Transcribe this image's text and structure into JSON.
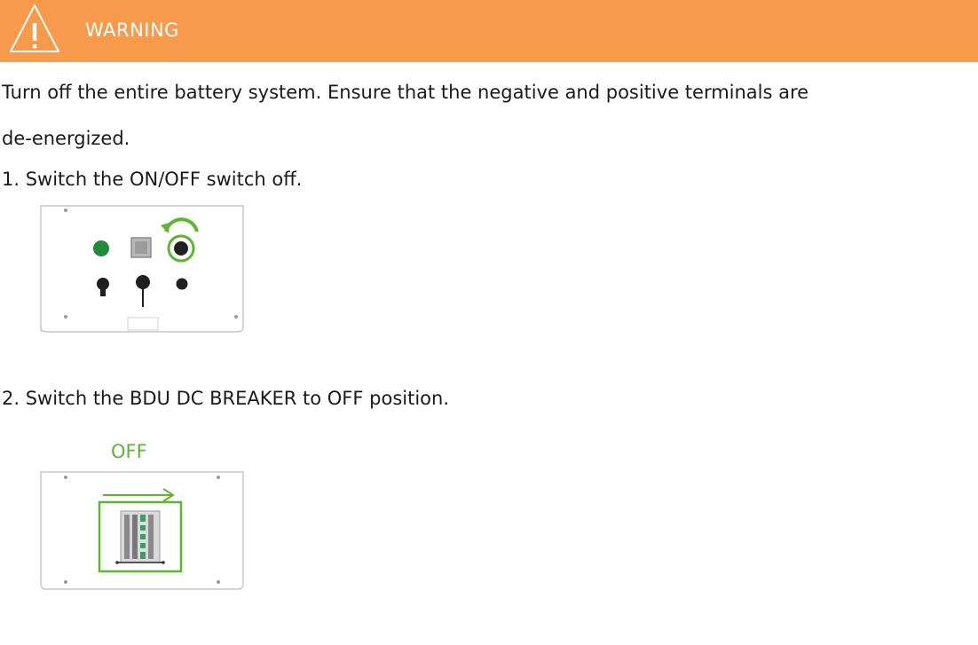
{
  "banner": {
    "label": "WARNING",
    "background_color": "#f79a4c",
    "icon": "warning-triangle-icon"
  },
  "body": {
    "paragraph_line1": "Turn off the entire battery system. Ensure that the negative and positive terminals are",
    "paragraph_line2": "de-energized."
  },
  "steps": [
    {
      "label": "1.  Switch the ON/OFF switch off.",
      "figure": "battery-panel-switch-figure",
      "icon": "rotate-arrow-icon"
    },
    {
      "label": "2.  Switch the BDU DC BREAKER to OFF position.",
      "figure": "bdu-breaker-figure",
      "callout": "OFF",
      "icon": "right-arrow-icon"
    }
  ],
  "accent_color": "#5db531"
}
